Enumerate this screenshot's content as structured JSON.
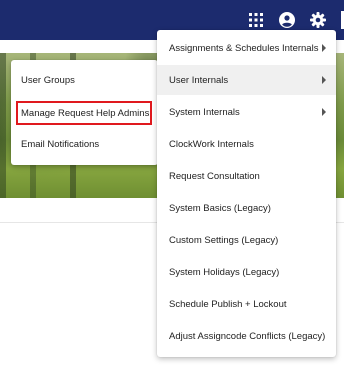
{
  "header": {
    "icons": [
      "apps-grid-icon",
      "account-circle-icon",
      "settings-gear-icon"
    ]
  },
  "left_menu": {
    "items": [
      {
        "label": "User Groups"
      },
      {
        "label": "Manage Request Help Admins"
      },
      {
        "label": "Email Notifications"
      }
    ]
  },
  "right_menu": {
    "items": [
      {
        "label": "Assignments & Schedules Internals",
        "has_submenu": true
      },
      {
        "label": "User Internals",
        "has_submenu": true,
        "active": true
      },
      {
        "label": "System Internals",
        "has_submenu": true
      },
      {
        "label": "ClockWork Internals",
        "has_submenu": false
      },
      {
        "label": "Request Consultation",
        "has_submenu": false
      },
      {
        "label": "System Basics (Legacy)",
        "has_submenu": false
      },
      {
        "label": "Custom Settings (Legacy)",
        "has_submenu": false
      },
      {
        "label": "System Holidays (Legacy)",
        "has_submenu": false
      },
      {
        "label": "Schedule Publish + Lockout",
        "has_submenu": false
      },
      {
        "label": "Adjust Assigncode Conflicts (Legacy)",
        "has_submenu": false
      }
    ]
  },
  "colors": {
    "header_bg": "#1c2b6e",
    "highlight": "#e0191e"
  }
}
